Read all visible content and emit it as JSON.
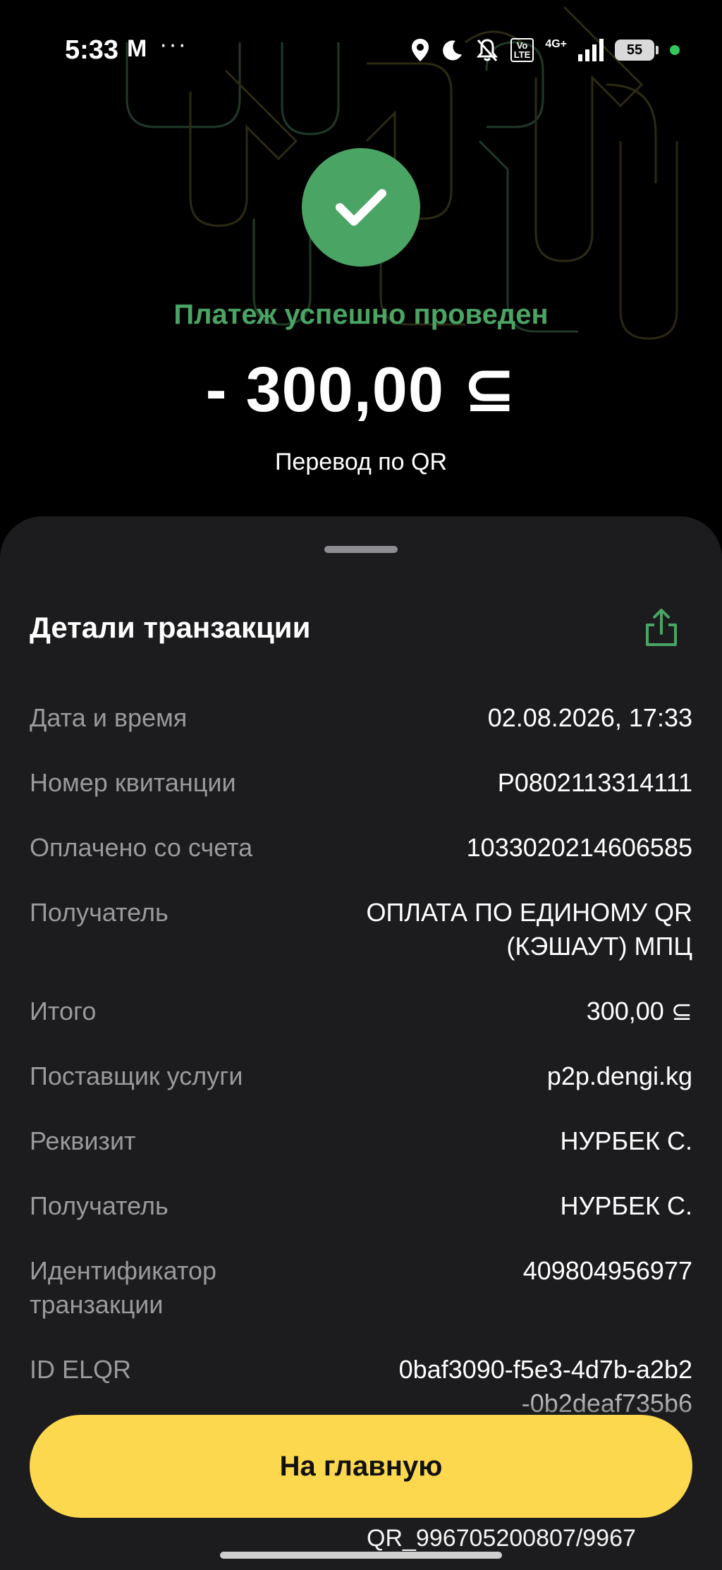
{
  "status_bar": {
    "time": "5:33",
    "app_icon_label": "M",
    "more_indicator": "···",
    "volte_label": "Vo\nLTE",
    "network_label": "4G+",
    "battery_level": "55"
  },
  "header": {
    "status_text": "Платеж успешно проведен",
    "amount": "- 300,00 ⊆",
    "subtitle": "Перевод по QR"
  },
  "details": {
    "title": "Детали транзакции",
    "rows": [
      {
        "label": "Дата и время",
        "value": "02.08.2026, 17:33"
      },
      {
        "label": "Номер квитанции",
        "value": "P0802113314111"
      },
      {
        "label": "Оплачено со счета",
        "value": "1033020214606585"
      },
      {
        "label": "Получатель",
        "value": "ОПЛАТА ПО ЕДИНОМУ QR (КЭШАУТ) МПЦ"
      },
      {
        "label": "Итого",
        "value": "300,00 ⊆"
      },
      {
        "label": "Поставщик услуги",
        "value": "p2p.dengi.kg"
      },
      {
        "label": "Реквизит",
        "value": "НУРБЕК С."
      },
      {
        "label": "Получатель",
        "value": "НУРБЕК С."
      },
      {
        "label": "Идентификатор транзакции",
        "value": "409804956977"
      },
      {
        "label": "ID ELQR",
        "value": "0baf3090-f5e3-4d7b-a2b2-0b2deaf735b6"
      }
    ],
    "partial_bottom_text": "QR_996705200807/9967"
  },
  "actions": {
    "home_button": "На главную"
  },
  "colors": {
    "success_green": "#4aa464",
    "button_yellow": "#fcd84e",
    "sheet_bg": "#1c1c1e"
  }
}
